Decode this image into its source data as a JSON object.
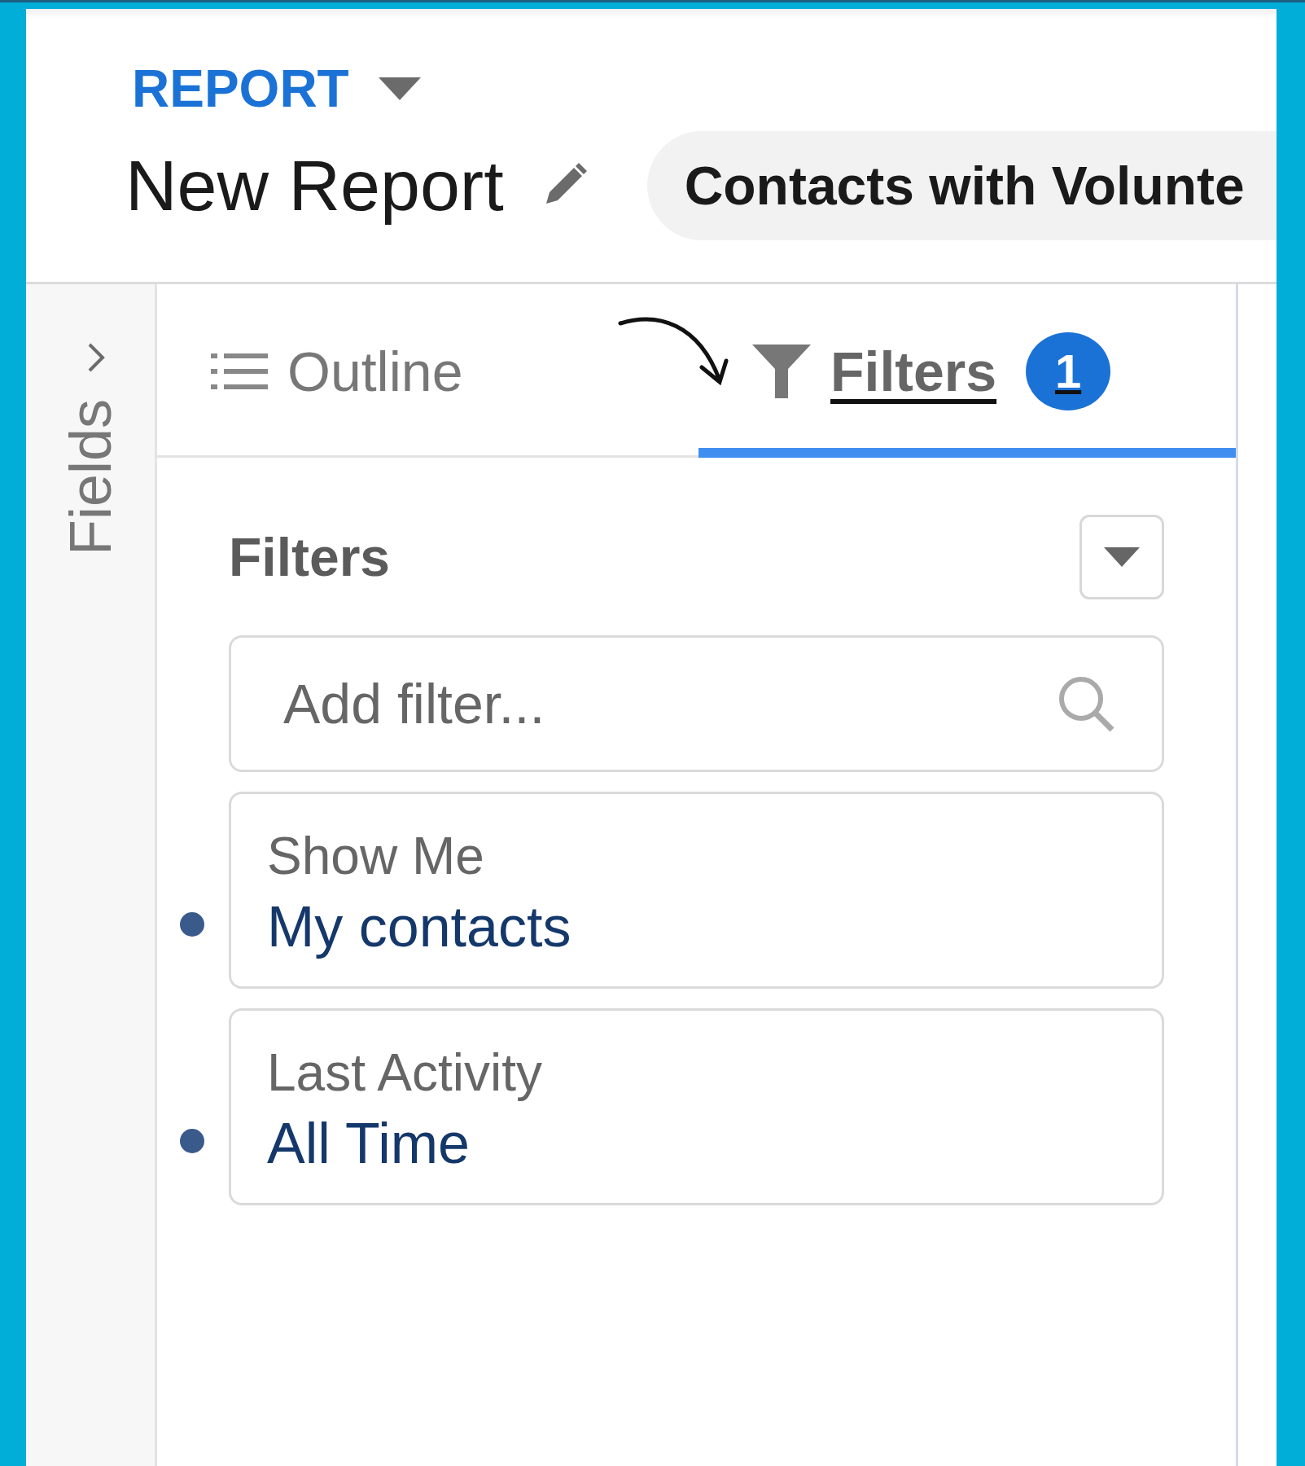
{
  "header": {
    "object_label": "REPORT",
    "title": "New Report",
    "report_type": "Contacts with Volunte"
  },
  "sidebar": {
    "label": "Fields"
  },
  "tabs": [
    {
      "kind": "outline",
      "label": "Outline",
      "selected": false
    },
    {
      "kind": "filters",
      "label": "Filters",
      "selected": true,
      "badge": "1"
    }
  ],
  "filters": {
    "heading": "Filters",
    "search": {
      "placeholder": "Add filter..."
    },
    "items": [
      {
        "label": "Show Me",
        "value": "My contacts"
      },
      {
        "label": "Last Activity",
        "value": "All Time"
      }
    ]
  }
}
